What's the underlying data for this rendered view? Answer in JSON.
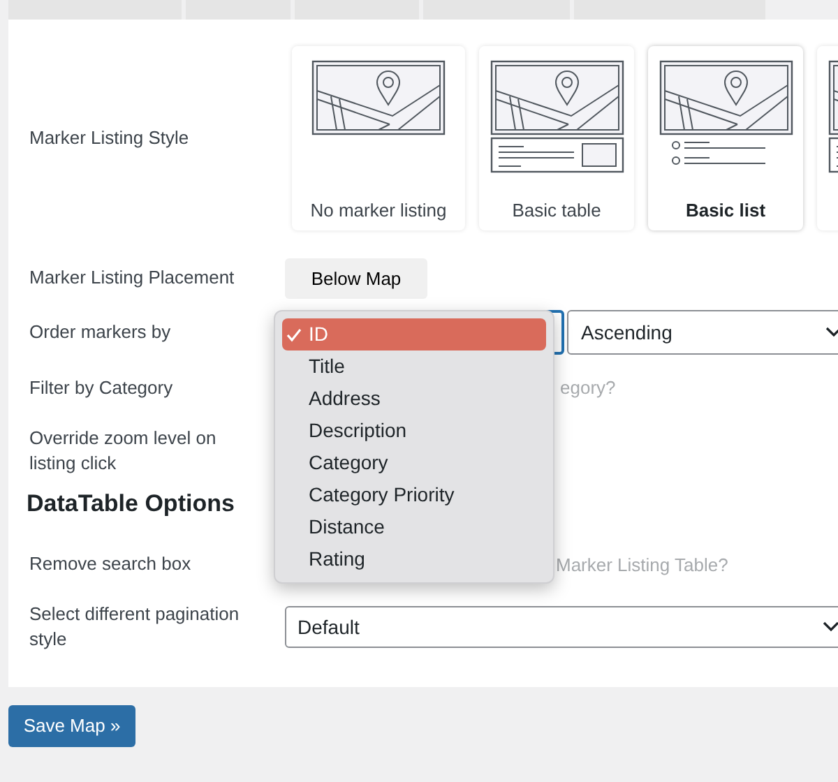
{
  "marker_listing_style": {
    "label": "Marker Listing Style",
    "options": [
      {
        "label": "No marker listing",
        "kind": "none",
        "selected": false
      },
      {
        "label": "Basic table",
        "kind": "table",
        "selected": false
      },
      {
        "label": "Basic list",
        "kind": "list",
        "selected": true
      },
      {
        "kind": "table",
        "selected": false
      }
    ]
  },
  "marker_listing_placement": {
    "label": "Marker Listing Placement",
    "button": "Below Map"
  },
  "order_markers_by": {
    "label": "Order markers by",
    "direction": "Ascending",
    "menu": [
      {
        "label": "ID",
        "selected": true
      },
      {
        "label": "Title",
        "selected": false
      },
      {
        "label": "Address",
        "selected": false
      },
      {
        "label": "Description",
        "selected": false
      },
      {
        "label": "Category",
        "selected": false
      },
      {
        "label": "Category Priority",
        "selected": false
      },
      {
        "label": "Distance",
        "selected": false
      },
      {
        "label": "Rating",
        "selected": false
      }
    ]
  },
  "filter_by_category": {
    "label": "Filter by Category",
    "description": "egory?"
  },
  "override_zoom": {
    "label": "Override zoom level on listing click"
  },
  "datatable_heading": "DataTable Options",
  "remove_search_box": {
    "label": "Remove search box",
    "description": "Marker Listing Table?"
  },
  "pagination_style": {
    "label": "Select different pagination style",
    "value": "Default"
  },
  "save_button": "Save Map »"
}
